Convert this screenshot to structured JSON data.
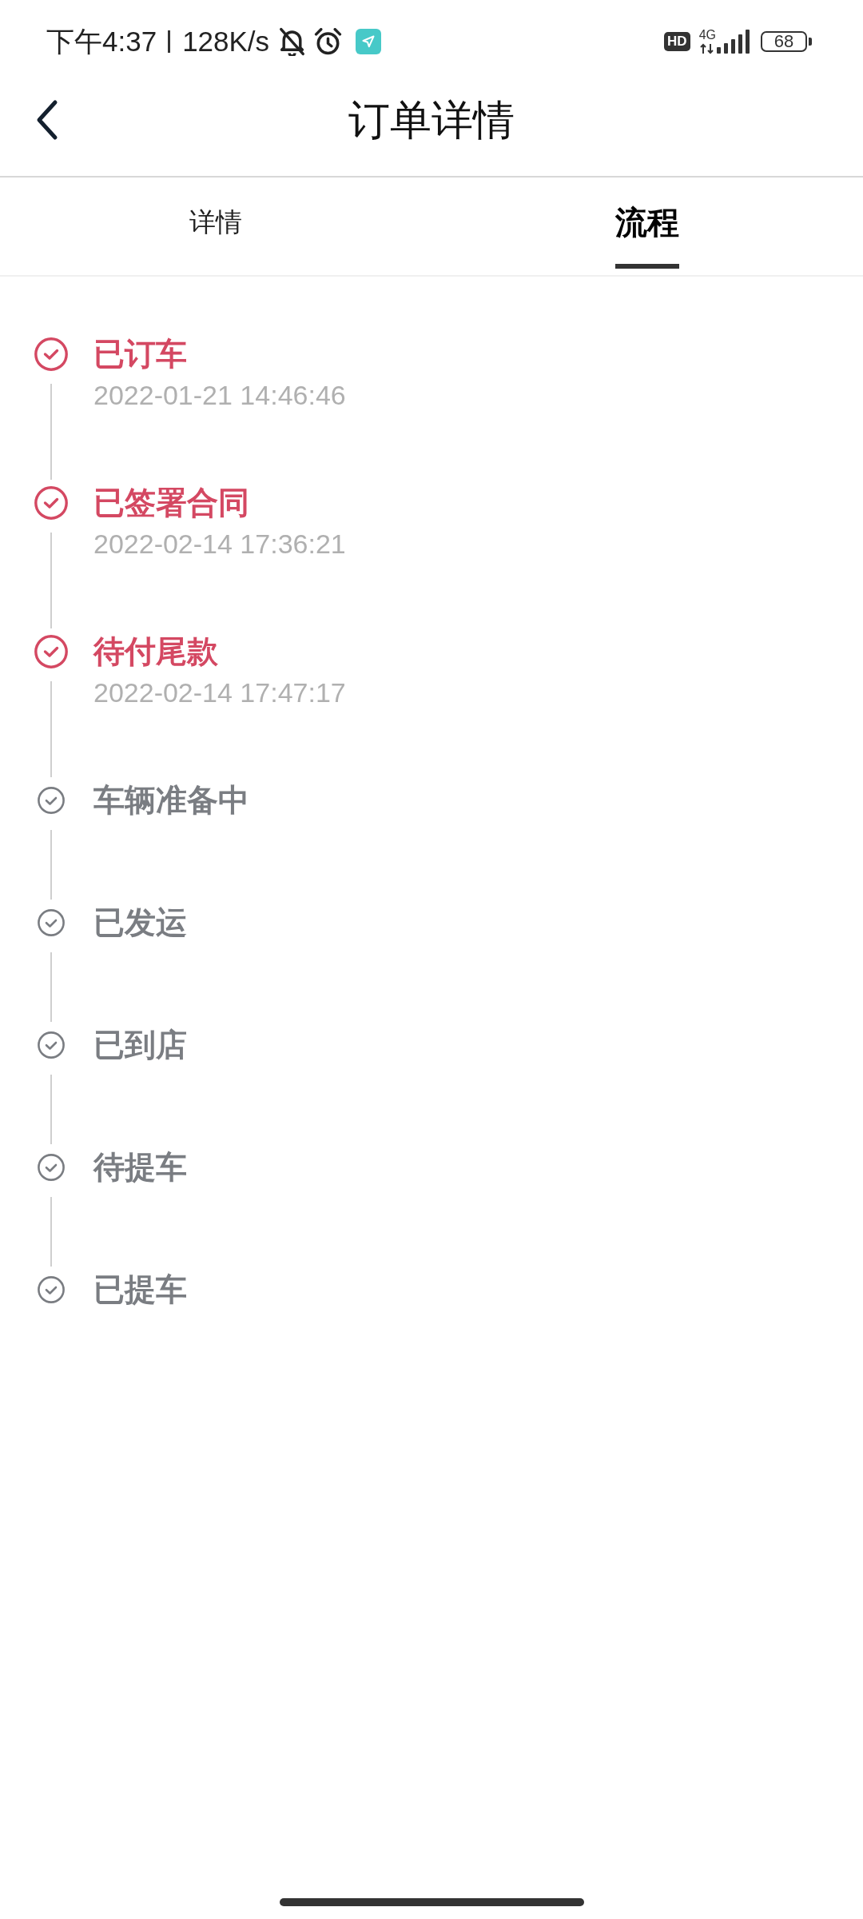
{
  "status_bar": {
    "time": "下午4:37",
    "network_speed": "128K/s",
    "hd_badge": "HD",
    "network_type": "4G",
    "battery": "68"
  },
  "header": {
    "title": "订单详情"
  },
  "tabs": [
    {
      "label": "详情",
      "selected": false
    },
    {
      "label": "流程",
      "selected": true
    }
  ],
  "steps": [
    {
      "label": "已订车",
      "completed": true,
      "time": "2022-01-21 14:46:46"
    },
    {
      "label": "已签署合同",
      "completed": true,
      "time": "2022-02-14 17:36:21"
    },
    {
      "label": "待付尾款",
      "completed": true,
      "time": "2022-02-14 17:47:17"
    },
    {
      "label": "车辆准备中",
      "completed": false
    },
    {
      "label": "已发运",
      "completed": false
    },
    {
      "label": "已到店",
      "completed": false
    },
    {
      "label": "待提车",
      "completed": false
    },
    {
      "label": "已提车",
      "completed": false
    }
  ]
}
